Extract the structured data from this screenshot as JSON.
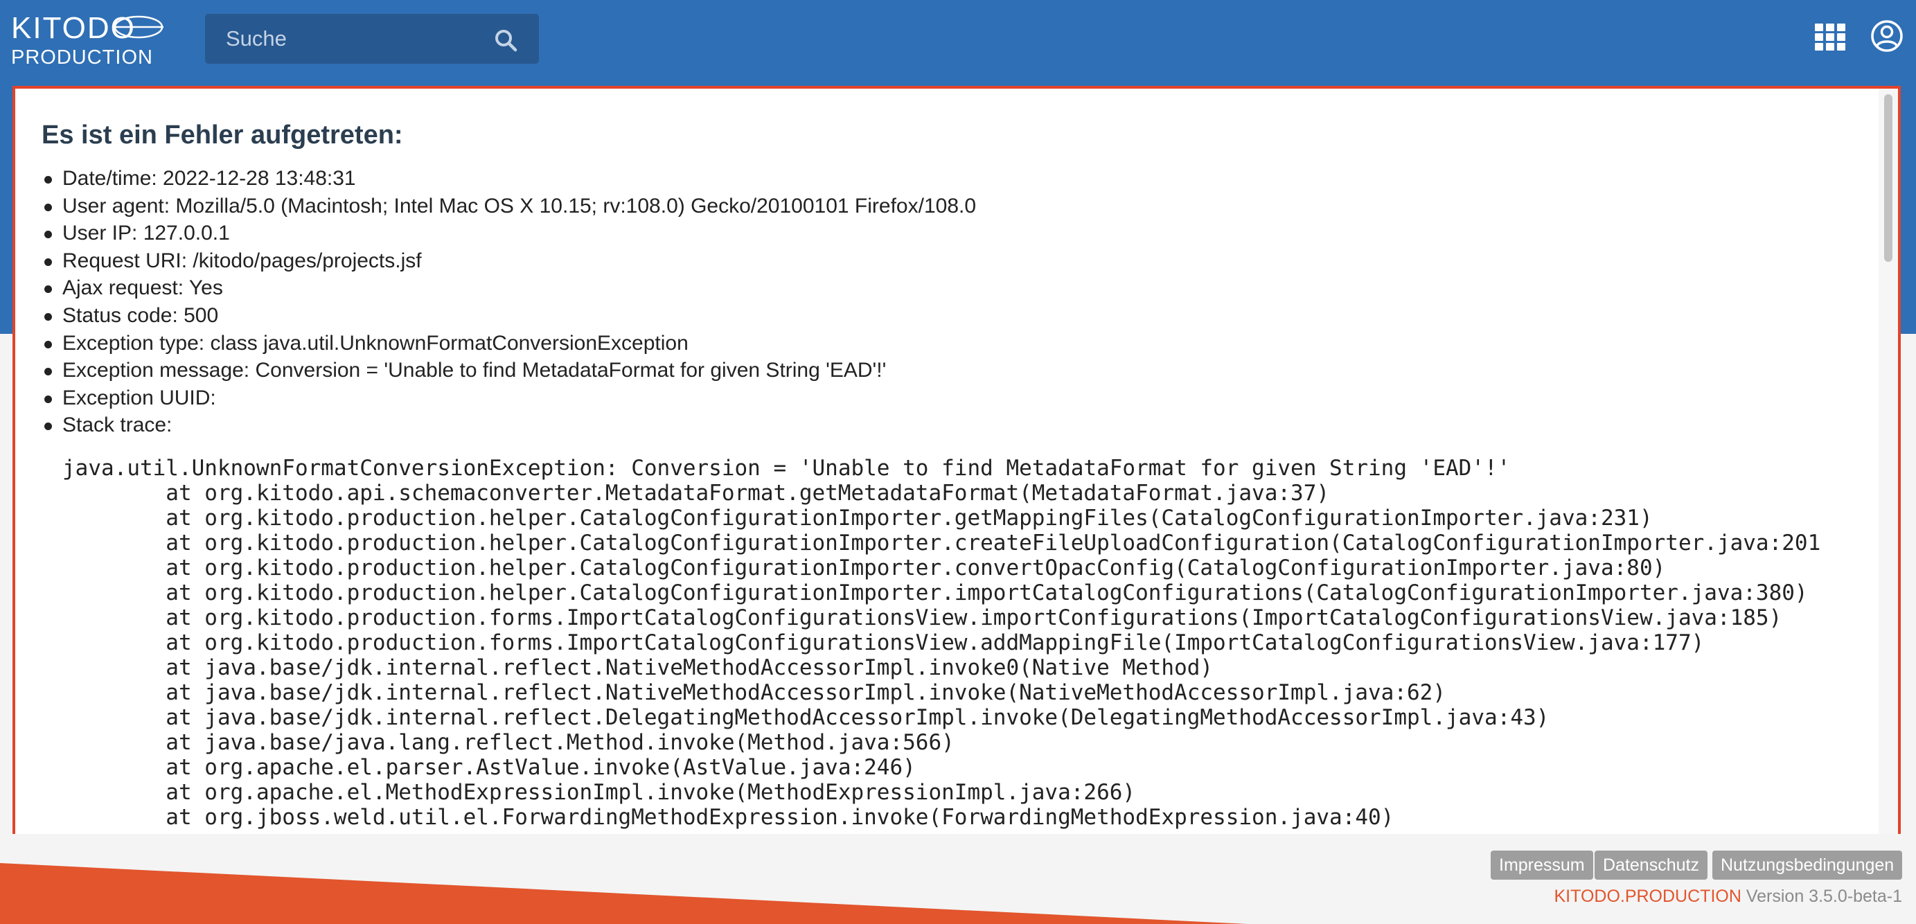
{
  "app": {
    "logo_top": "KITODO",
    "logo_bottom": "PRODUCTION"
  },
  "header": {
    "search_placeholder": "Suche",
    "icons": [
      "search-icon",
      "apps-grid-icon",
      "user-icon"
    ]
  },
  "colors": {
    "header_blue": "#2f6fb5",
    "search_bg": "#27588f",
    "error_border": "#e2432a",
    "footer_accent": "#e2552d",
    "button_gray": "#9e9e9e"
  },
  "dialog": {
    "title": "Es ist ein Fehler aufgetreten:",
    "info": [
      "Date/time: 2022-12-28 13:48:31",
      "User agent: Mozilla/5.0 (Macintosh; Intel Mac OS X 10.15; rv:108.0) Gecko/20100101 Firefox/108.0",
      "User IP: 127.0.0.1",
      "Request URI: /kitodo/pages/projects.jsf",
      "Ajax request: Yes",
      "Status code: 500",
      "Exception type: class java.util.UnknownFormatConversionException",
      "Exception message: Conversion = 'Unable to find MetadataFormat for given String 'EAD'!'",
      "Exception UUID:",
      "Stack trace:"
    ],
    "stack_trace": "java.util.UnknownFormatConversionException: Conversion = 'Unable to find MetadataFormat for given String 'EAD'!'\n        at org.kitodo.api.schemaconverter.MetadataFormat.getMetadataFormat(MetadataFormat.java:37)\n        at org.kitodo.production.helper.CatalogConfigurationImporter.getMappingFiles(CatalogConfigurationImporter.java:231)\n        at org.kitodo.production.helper.CatalogConfigurationImporter.createFileUploadConfiguration(CatalogConfigurationImporter.java:201\n        at org.kitodo.production.helper.CatalogConfigurationImporter.convertOpacConfig(CatalogConfigurationImporter.java:80)\n        at org.kitodo.production.helper.CatalogConfigurationImporter.importCatalogConfigurations(CatalogConfigurationImporter.java:380)\n        at org.kitodo.production.forms.ImportCatalogConfigurationsView.importConfigurations(ImportCatalogConfigurationsView.java:185)\n        at org.kitodo.production.forms.ImportCatalogConfigurationsView.addMappingFile(ImportCatalogConfigurationsView.java:177)\n        at java.base/jdk.internal.reflect.NativeMethodAccessorImpl.invoke0(Native Method)\n        at java.base/jdk.internal.reflect.NativeMethodAccessorImpl.invoke(NativeMethodAccessorImpl.java:62)\n        at java.base/jdk.internal.reflect.DelegatingMethodAccessorImpl.invoke(DelegatingMethodAccessorImpl.java:43)\n        at java.base/java.lang.reflect.Method.invoke(Method.java:566)\n        at org.apache.el.parser.AstValue.invoke(AstValue.java:246)\n        at org.apache.el.MethodExpressionImpl.invoke(MethodExpressionImpl.java:266)\n        at org.jboss.weld.util.el.ForwardingMethodExpression.invoke(ForwardingMethodExpression.java:40)"
  },
  "footer": {
    "links": [
      "Impressum",
      "Datenschutz",
      "Nutzungsbedingungen"
    ],
    "brand": "KITODO.PRODUCTION",
    "version": "Version 3.5.0-beta-1"
  }
}
